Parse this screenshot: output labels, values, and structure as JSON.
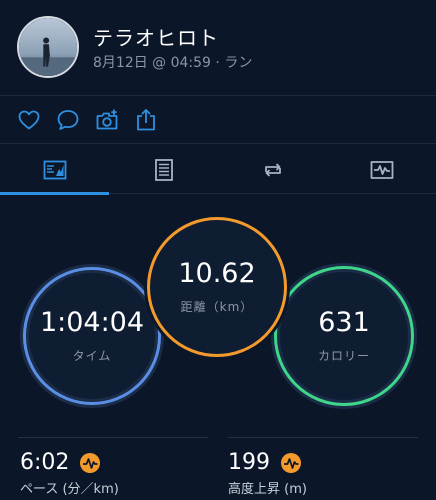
{
  "activity": {
    "user_name": "テラオヒロト",
    "meta": "8月12日 @ 04:59 · ラン"
  },
  "actions": {
    "icons": [
      "heart-icon",
      "comment-icon",
      "camera-icon",
      "share-icon"
    ]
  },
  "tabs": {
    "items": [
      "overview",
      "details",
      "laps",
      "charts"
    ],
    "active": "overview"
  },
  "summary": {
    "time": {
      "value": "1:04:04",
      "label": "タイム"
    },
    "distance": {
      "value": "10.62",
      "label": "距離（km）"
    },
    "calories": {
      "value": "631",
      "label": "カロリー"
    }
  },
  "stats": {
    "pace": {
      "value": "6:02",
      "label": "ペース (分／km)"
    },
    "elevation": {
      "value": "199",
      "label": "高度上昇 (m)"
    }
  },
  "colors": {
    "background": "#0b1628",
    "accent": "#2f8fe0",
    "time_ring": "#5b8fe6",
    "distance_ring": "#f39a2c",
    "calories_ring": "#3fd68a",
    "badge": "#f39a2c"
  }
}
